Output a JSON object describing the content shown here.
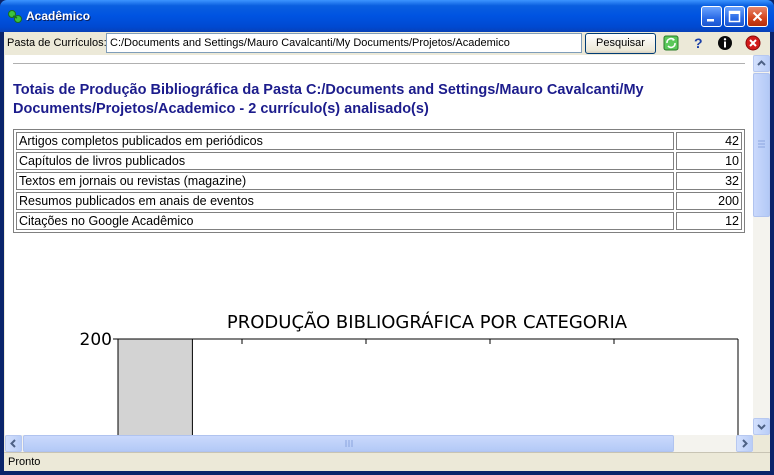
{
  "window": {
    "title": "Acadêmico"
  },
  "toolbar": {
    "path_label": "Pasta de Currículos:",
    "path_value": "C:/Documents and Settings/Mauro Cavalcanti/My Documents/Projetos/Academico",
    "search_label": "Pesquisar",
    "icons": [
      "refresh-icon",
      "help-icon",
      "info-icon",
      "close-app-icon"
    ]
  },
  "report": {
    "heading": "Totais de Produção Bibliográfica da Pasta C:/Documents and Settings/Mauro Cavalcanti/My Documents/Projetos/Academico - 2 currículo(s) analisado(s)",
    "rows": [
      {
        "label": "Artigos completos publicados em periódicos",
        "value": "42"
      },
      {
        "label": "Capítulos de livros publicados",
        "value": "10"
      },
      {
        "label": "Textos em jornais ou revistas (magazine)",
        "value": "32"
      },
      {
        "label": "Resumos publicados em anais de eventos",
        "value": "200"
      },
      {
        "label": "Citações no Google Acadêmico",
        "value": "12"
      }
    ]
  },
  "chart_data": {
    "type": "bar",
    "title": "PRODUÇÃO BIBLIOGRÁFICA POR CATEGORIA",
    "categories": [
      "",
      "",
      "",
      "",
      ""
    ],
    "values": [
      200,
      0,
      0,
      0,
      0
    ],
    "ylim_visible": [
      150,
      200
    ],
    "yticks": [
      200,
      150
    ],
    "bar_color": "#d3d3d3"
  },
  "status": {
    "text": "Pronto"
  },
  "colors": {
    "title_bar": "#0054e3",
    "heading": "#1c1c8c"
  }
}
